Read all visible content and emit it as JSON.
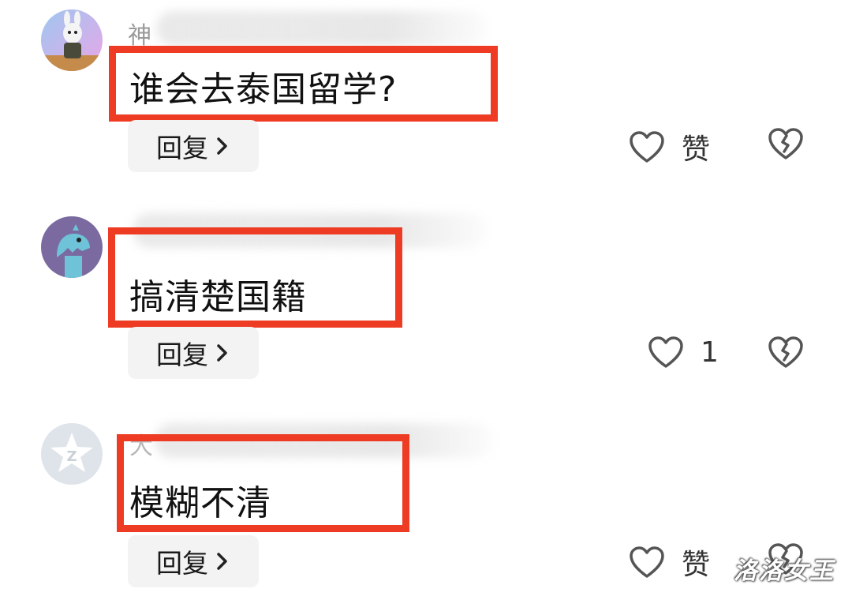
{
  "comments": [
    {
      "username": "神",
      "text": "谁会去泰国留学?",
      "reply_label": "回复",
      "like_label": "赞"
    },
    {
      "username": "",
      "text": "搞清楚国籍",
      "reply_label": "回复",
      "like_label": "1"
    },
    {
      "username": "大",
      "text": "模糊不清",
      "reply_label": "回复",
      "like_label": "赞"
    }
  ],
  "watermark": "洛洛女王",
  "colors": {
    "highlight": "#ee3b23",
    "reply_bg": "#f3f3f3",
    "icon_stroke": "#555555"
  },
  "icons": {
    "like": "heart-outline-icon",
    "dislike": "broken-heart-icon",
    "chevron": "chevron-right-icon"
  }
}
